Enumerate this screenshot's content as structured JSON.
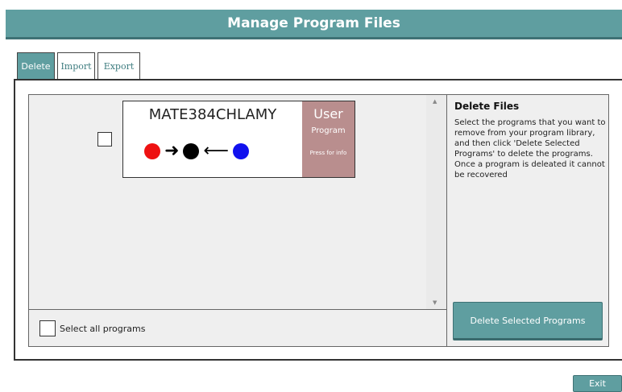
{
  "header": {
    "title": "Manage Program Files"
  },
  "tabs": [
    {
      "label": "Delete"
    },
    {
      "label": "Import"
    },
    {
      "label": "Export"
    }
  ],
  "programs": [
    {
      "name": "MATE384CHLAMY",
      "badge": {
        "type": "User",
        "kind": "Program",
        "info": "Press for info"
      },
      "diagram": [
        "red-dot",
        "right-arrow-icon",
        "black-dot",
        "left-arrow-icon",
        "blue-dot"
      ]
    }
  ],
  "select_all": {
    "label": "Select all programs"
  },
  "help": {
    "title": "Delete Files",
    "body": "Select the programs that you want to remove from your program library, and then click 'Delete Selected Programs' to delete the programs. Once a program is deleated it cannot be recovered"
  },
  "actions": {
    "delete_label": "Delete Selected Programs",
    "exit_label": "Exit"
  },
  "colors": {
    "accent": "#5f9ea0",
    "user_badge": "#b98e8e",
    "dot_red": "#ee1111",
    "dot_black": "#000000",
    "dot_blue": "#1111ee"
  }
}
